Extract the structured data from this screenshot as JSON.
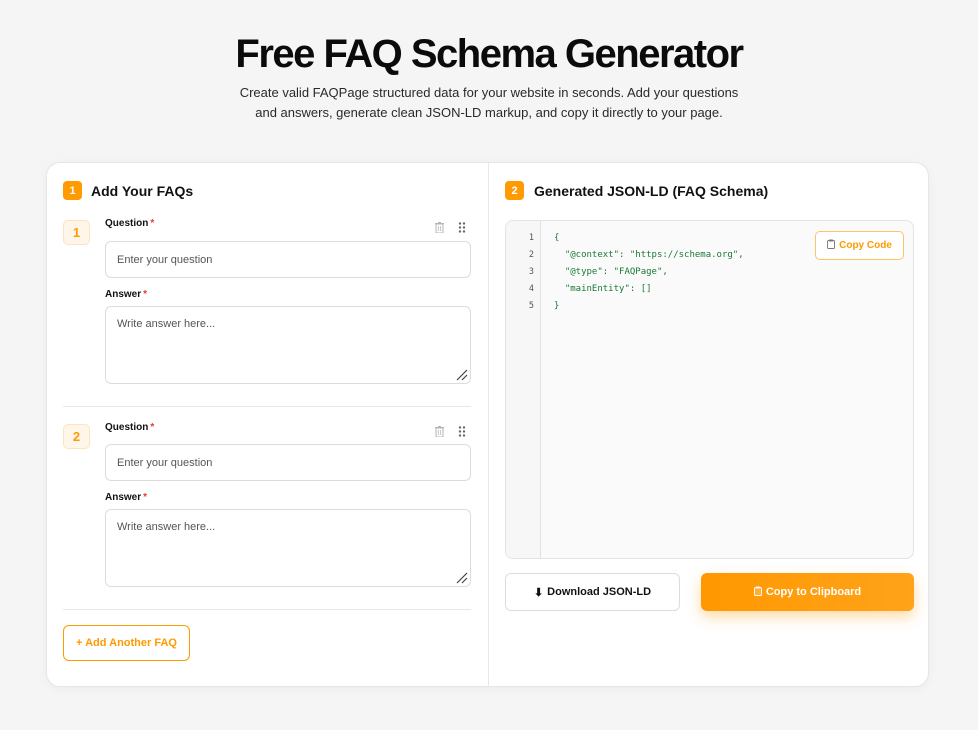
{
  "header": {
    "title": "Free FAQ Schema Generator",
    "subtitle": "Create valid FAQPage structured data for your website in seconds. Add your questions and answers, generate clean JSON-LD markup, and copy it directly to your page."
  },
  "left": {
    "badge": "1",
    "title": "Add Your FAQs",
    "items": [
      {
        "number": "1",
        "question_label": "Question",
        "question_placeholder": "Enter your question",
        "answer_label": "Answer",
        "answer_placeholder": "Write answer here..."
      },
      {
        "number": "2",
        "question_label": "Question",
        "question_placeholder": "Enter your question",
        "answer_label": "Answer",
        "answer_placeholder": "Write answer here..."
      }
    ],
    "required_mark": "*",
    "add_button": "+ Add Another FAQ"
  },
  "right": {
    "badge": "2",
    "title": "Generated JSON-LD (FAQ Schema)",
    "line_numbers": [
      "1",
      "2",
      "3",
      "4",
      "5"
    ],
    "code_lines": [
      "{",
      "  \"@context\": \"https://schema.org\",",
      "  \"@type\": \"FAQPage\",",
      "  \"mainEntity\": []",
      "}"
    ],
    "copy_code_label": "Copy Code",
    "download_label": "Download JSON-LD",
    "download_icon": "⬇",
    "clipboard_label": "Copy to Clipboard"
  },
  "colors": {
    "accent": "#ff9a00",
    "required": "#e53935",
    "code_text": "#1a7a37"
  },
  "icons": {
    "trash": "trash-icon",
    "drag": "drag-handle-icon",
    "clipboard": "clipboard-icon",
    "download": "download-icon"
  }
}
